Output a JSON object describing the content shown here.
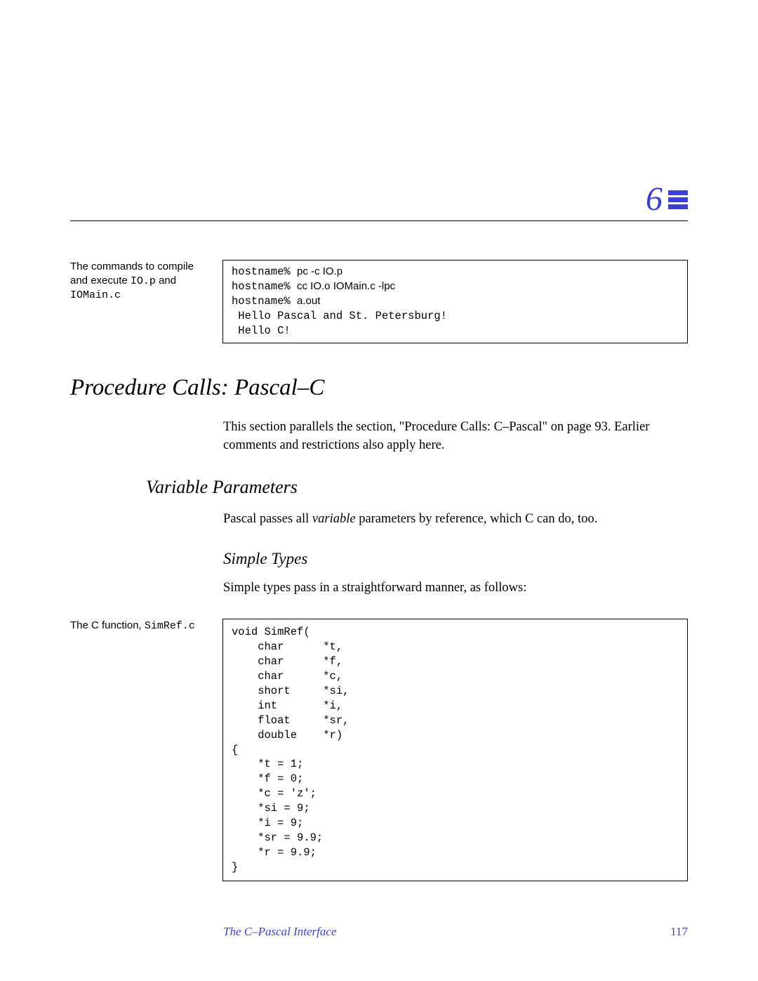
{
  "chapter_number": "6",
  "side_note_1": {
    "prefix": "The commands to compile and execute ",
    "file1": "IO.p",
    "mid": " and ",
    "file2": "IOMain.c"
  },
  "codebox1": {
    "prompt1": "hostname% ",
    "cmd1": "pc -c IO.p",
    "prompt2": "hostname% ",
    "cmd2": "cc IO.o IOMain.c -lpc",
    "prompt3": "hostname% ",
    "cmd3": "a.out",
    "out1": " Hello Pascal and St. Petersburg!",
    "out2": " Hello C!"
  },
  "h1": "Procedure Calls: Pascal–C",
  "para1": "This section parallels the section, \"Procedure Calls: C–Pascal\" on page 93. Earlier comments and restrictions also apply here.",
  "h2": "Variable Parameters",
  "para2_a": "Pascal passes all ",
  "para2_ital": "variable",
  "para2_b": " parameters by reference, which C can do, too.",
  "h3": "Simple Types",
  "para3": "Simple types pass in a straightforward manner, as follows:",
  "side_note_2": {
    "prefix": "The C function, ",
    "file": "SimRef.c"
  },
  "codebox2": "void SimRef(\n    char      *t,\n    char      *f,\n    char      *c,\n    short     *si,\n    int       *i,\n    float     *sr,\n    double    *r)\n{\n    *t = 1;\n    *f = 0;\n    *c = 'z';\n    *si = 9;\n    *i = 9;\n    *sr = 9.9;\n    *r = 9.9;\n}",
  "footer": {
    "title": "The C–Pascal Interface",
    "page": "117"
  }
}
